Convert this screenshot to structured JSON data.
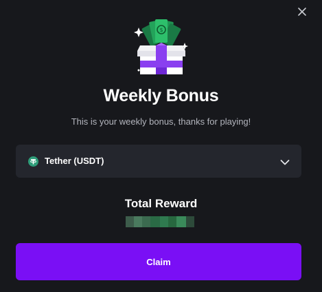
{
  "modal": {
    "title": "Weekly Bonus",
    "subtitle": "This is your weekly bonus, thanks for playing!",
    "close_icon": "close-icon",
    "hero_icon": "gift-box-with-cash-icon"
  },
  "currency_select": {
    "selected": "Tether (USDT)",
    "token_icon": "tether-icon",
    "chevron_icon": "chevron-down-icon"
  },
  "reward": {
    "label": "Total Reward",
    "value_obscured": true
  },
  "actions": {
    "claim_label": "Claim"
  },
  "colors": {
    "background": "#17181c",
    "panel": "#24262d",
    "accent": "#7a0ff5",
    "tether_green": "#2e9d79",
    "subtitle_text": "#b3b5bd"
  }
}
